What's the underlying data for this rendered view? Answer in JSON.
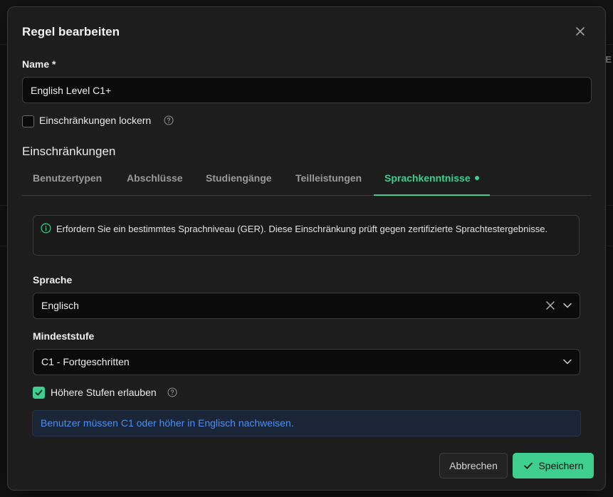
{
  "dialog": {
    "title": "Regel bearbeiten"
  },
  "name_field": {
    "label": "Name *",
    "value": "English Level C1+"
  },
  "relax_checkbox": {
    "label": "Einschränkungen lockern",
    "checked": false
  },
  "restrictions": {
    "title": "Einschränkungen",
    "tabs": [
      {
        "label": "Benutzertypen",
        "active": false
      },
      {
        "label": "Abschlüsse",
        "active": false
      },
      {
        "label": "Studiengänge",
        "active": false
      },
      {
        "label": "Teilleistungen",
        "active": false
      },
      {
        "label": "Sprachkenntnisse",
        "active": true
      }
    ]
  },
  "language_panel": {
    "info_text": "Erfordern Sie ein bestimmtes Sprachniveau (GER). Diese Einschränkung prüft gegen zertifizierte Sprachtestergebnisse.",
    "language_label": "Sprache",
    "language_value": "Englisch",
    "level_label": "Mindeststufe",
    "level_value": "C1 - Fortgeschritten",
    "allow_higher_label": "Höhere Stufen erlauben",
    "allow_higher_checked": true,
    "summary": "Benutzer müssen C1 oder höher in Englisch nachweisen."
  },
  "footer": {
    "cancel_label": "Abbrechen",
    "save_label": "Speichern"
  },
  "colors": {
    "accent": "#3ecf8e",
    "info_blue": "#4a8ff0"
  }
}
